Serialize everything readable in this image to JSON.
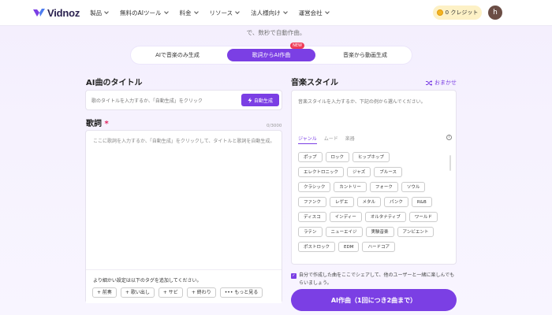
{
  "brand": {
    "name": "Vidnoz",
    "accent": "#7b3fe4"
  },
  "nav": {
    "items": [
      "製品",
      "無料のAIツール",
      "料金",
      "リソース",
      "法人様向け",
      "運営会社"
    ],
    "credits": "0 クレジット",
    "avatar_initial": "h"
  },
  "hero": {
    "subtitle": "で、数秒で自動作曲。"
  },
  "tabs": {
    "items": [
      "AIで音楽のみ生成",
      "歌詞からAI作曲",
      "音楽から動画生成"
    ],
    "badge": "NEW"
  },
  "title_section": {
    "heading": "AI曲のタイトル",
    "placeholder": "歌のタイトルを入力するか、「自動生成」をクリック",
    "auto_button": "自動生成"
  },
  "lyrics_section": {
    "heading": "歌詞",
    "required_mark": "*",
    "counter": "0/3000",
    "placeholder": "ここに歌詞を入力するか、「自動生成」をクリックして、タイトルと歌詞を自動生成。",
    "tags_hint": "より細かい設定は以下のタグを追加してください。",
    "tags": [
      "+ 前奏",
      "+ 歌い出し",
      "+ サビ",
      "+ 終わり",
      "••• もっと見る"
    ]
  },
  "style_section": {
    "heading": "音楽スタイル",
    "omakase": "おまかせ",
    "placeholder": "音楽スタイルを入力するか、下記の例から選んでください。",
    "tabs": [
      "ジャンル",
      "ムード",
      "楽器"
    ],
    "genre_rows": [
      [
        "ポップ",
        "ロック",
        "ヒップホップ"
      ],
      [
        "エレクトロニック",
        "ジャズ",
        "ブルース"
      ],
      [
        "クラシック",
        "カントリー",
        "フォーク",
        "ソウル"
      ],
      [
        "ファンク",
        "レゲエ",
        "メタル",
        "パンク",
        "R&B"
      ],
      [
        "ディスコ",
        "インディー",
        "オルタナティブ",
        "ワールド"
      ],
      [
        "ラテン",
        "ニューエイジ",
        "実験音楽",
        "アンビエント"
      ],
      [
        "ポストロック",
        "EDM",
        "ハードコア"
      ]
    ]
  },
  "share": {
    "text": "自分で作成した曲をここでシェアして、他のユーザーと一緒に楽しんでもらいましょう。"
  },
  "cta": {
    "label": "AI作曲（1回につき2曲まで）"
  }
}
